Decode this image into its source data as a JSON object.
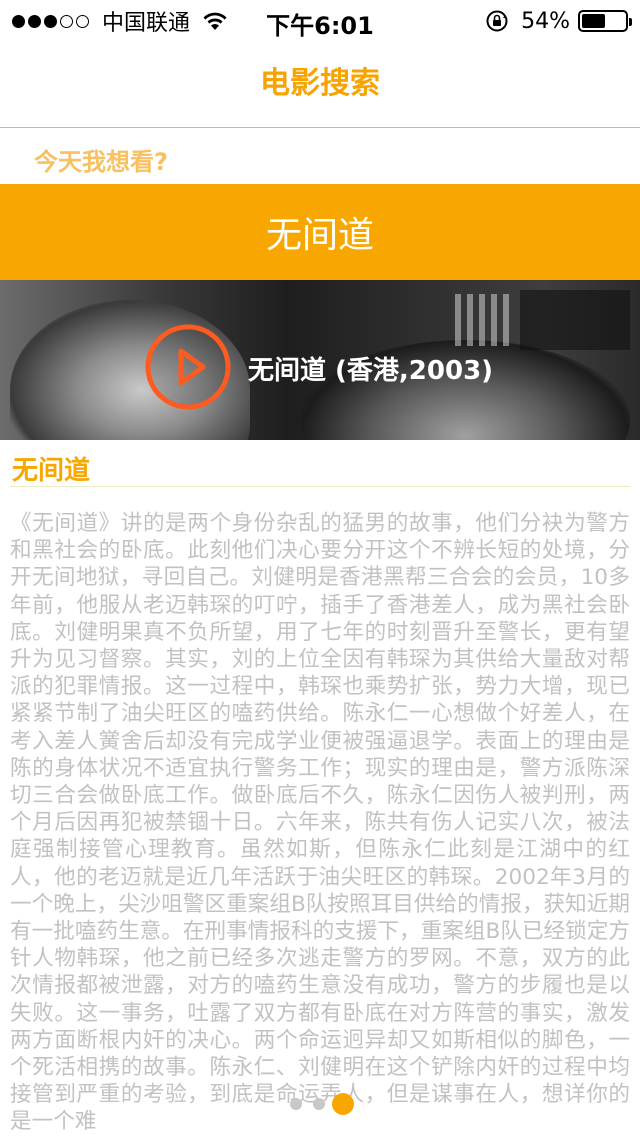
{
  "status_bar": {
    "carrier": "中国联通",
    "time": "下午6:01",
    "battery_text": "54%",
    "battery_level": 0.54,
    "signal_filled": 3,
    "signal_total": 5
  },
  "nav": {
    "title": "电影搜索"
  },
  "prompt": "今天我想看?",
  "movie": {
    "name": "无间道",
    "poster_caption": "无间道 (香港,2003)",
    "section_title": "无间道",
    "description": "《无间道》讲的是两个身份杂乱的猛男的故事，他们分袂为警方和黑社会的卧底。此刻他们决心要分开这个不辨长短的处境，分开无间地狱，寻回自己。刘健明是香港黑帮三合会的会员，10多年前，他服从老迈韩琛的叮咛，插手了香港差人，成为黑社会卧底。刘健明果真不负所望，用了七年的时刻晋升至警长，更有望升为见习督察。其实，刘的上位全因有韩琛为其供给大量敌对帮派的犯罪情报。这一过程中，韩琛也乘势扩张，势力大增，现已紧紧节制了油尖旺区的嗑药供给。陈永仁一心想做个好差人，在考入差人黉舍后却没有完成学业便被强逼退学。表面上的理由是陈的身体状况不适宜执行警务工作；现实的理由是，警方派陈深切三合会做卧底工作。做卧底后不久，陈永仁因伤人被判刑，两个月后因再犯被禁锢十日。六年来，陈共有伤人记实八次，被法庭强制接管心理教育。虽然如斯，但陈永仁此刻是江湖中的红人，他的老迈就是近几年活跃于油尖旺区的韩琛。2002年3月的一个晚上，尖沙咀警区重案组B队按照耳目供给的情报，获知近期有一批嗑药生意。在刑事情报科的支援下，重案组B队已经锁定方针人物韩琛，他之前已经多次逃走警方的罗网。不意，双方的此次情报都被泄露，对方的嗑药生意没有成功，警方的步履也是以失败。这一事务，吐露了双方都有卧底在对方阵营的事实，激发两方面断根内奸的决心。两个命运迥异却又如斯相似的脚色，一个死活相携的故事。陈永仁、刘健明在这个铲除内奸的过程中均接管到严重的考验，到底是命运弄人，但是谋事在人，想详你的是一个难"
  },
  "page_control": {
    "count": 3,
    "current": 2
  },
  "colors": {
    "accent": "#f8a600",
    "prompt": "#f8c060",
    "description_text": "#c2c2c2",
    "play_ring": "#ff5a1f"
  }
}
